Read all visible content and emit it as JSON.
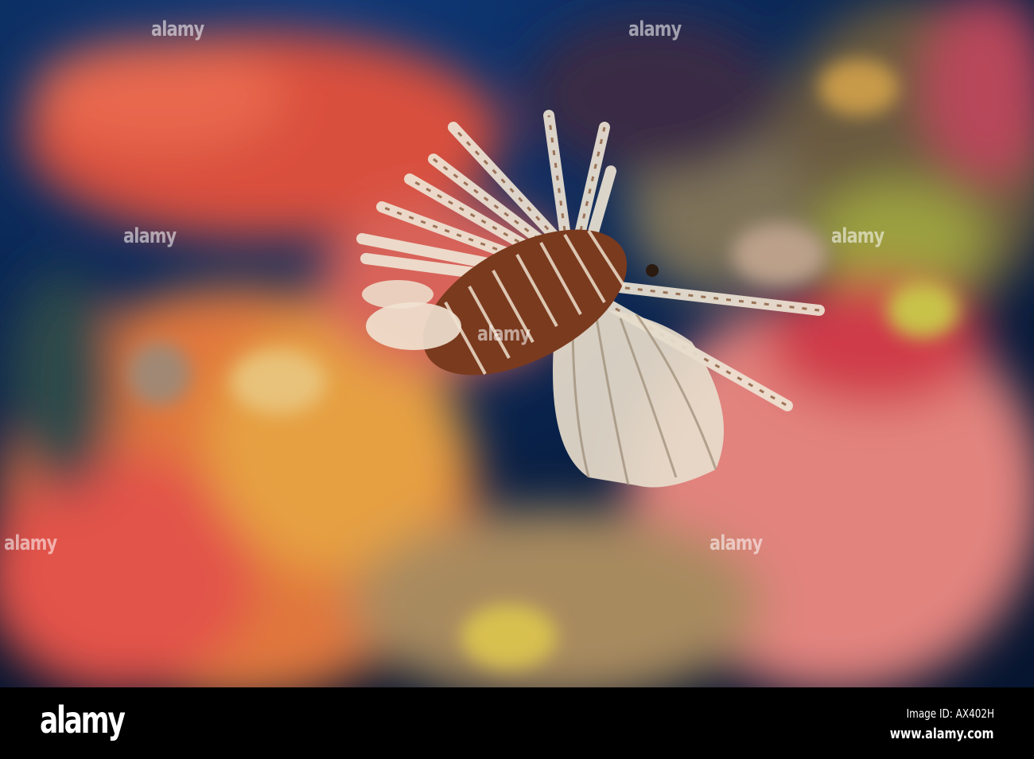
{
  "photo": {
    "subject": "Lionfish over soft coral reef",
    "watermark_text": "alamy",
    "colors": {
      "water": "#0b2350",
      "coral_red": "#e0553f",
      "coral_pink": "#e98a86",
      "coral_orange": "#e69a3a",
      "fin_white": "#efe6d6",
      "fish_brown": "#7a3a1e"
    }
  },
  "footer": {
    "logo": "alamy",
    "image_id": "Image ID: AX402H",
    "website": "www.alamy.com"
  }
}
